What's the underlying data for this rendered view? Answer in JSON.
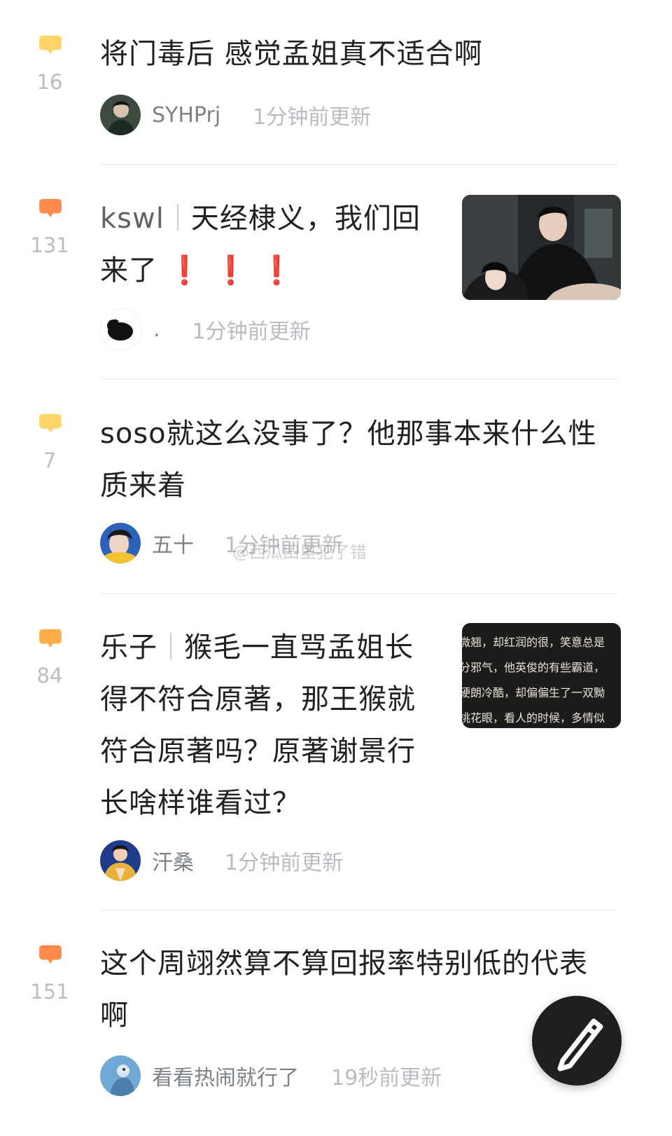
{
  "colors": {
    "bubble_yellow": "#ffd56a",
    "bubble_orange": "#ff8a4c",
    "divider": "#f2f3f4"
  },
  "posts": [
    {
      "count": "16",
      "title_lines": [
        "将门毒后 感觉孟姐真不适合啊"
      ],
      "user": "SYHPrj",
      "time": "1分钟前更新"
    },
    {
      "count": "131",
      "tag": "kswl",
      "title_lines": [
        "天经棣义，我们回",
        "来了"
      ],
      "exclaims": "❗ ❗ ❗",
      "user": ".",
      "time": "1分钟前更新"
    },
    {
      "count": "7",
      "title_lines": [
        "soso就这么没事了？他那事本来什么性",
        "质来着"
      ],
      "user": "五十",
      "time": "1分钟前更新"
    },
    {
      "count": "84",
      "tag": "乐子",
      "title_lines": [
        "猴毛一直骂孟姐长",
        "得不符合原著，那王猴就",
        "符合原著吗？原著谢景行",
        "长啥样谁看过？"
      ],
      "excerpt_lines": [
        "微翘，却红润的很，笑意总是",
        "分邪气，他英俊的有些霸道，",
        "硬朗冷酷，却偏偏生了一双黝",
        "桃花眼，看人的时候，多情似"
      ],
      "user": "汗桑",
      "time": "1分钟前更新"
    },
    {
      "count": "151",
      "title_lines": [
        "这个周翊然算不算回报率特别低的代表",
        "啊"
      ],
      "user": "看看热闹就行了",
      "time": "19秒前更新"
    }
  ],
  "watermark": "@西瓜田里犯了错",
  "fab_icon": "pencil-icon"
}
